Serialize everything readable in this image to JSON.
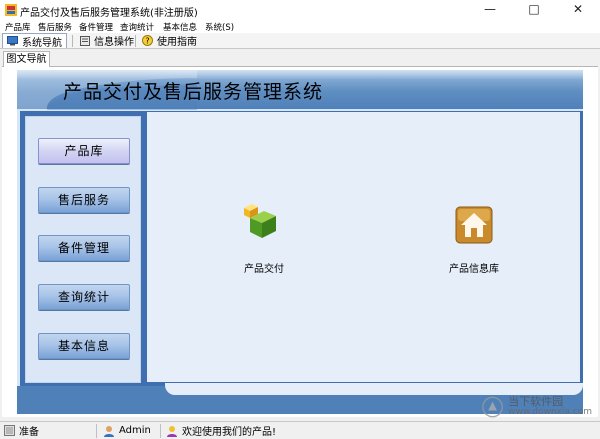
{
  "window": {
    "title": "产品交付及售后服务管理系统(非注册版)"
  },
  "menu": [
    "产品库",
    "售后服务",
    "备件管理",
    "查询统计",
    "基本信息",
    "系统(S)"
  ],
  "toolbar": {
    "nav_label": "系统导航",
    "info_label": "信息操作",
    "help_label": "使用指南"
  },
  "doc_tab": "图文导航",
  "banner_title": "产品交付及售后服务管理系统",
  "nav_buttons": [
    "产品库",
    "售后服务",
    "备件管理",
    "查询统计",
    "基本信息"
  ],
  "content": {
    "items": [
      {
        "label": "产品交付",
        "icon": "green-cube-icon"
      },
      {
        "label": "产品信息库",
        "icon": "house-icon"
      }
    ]
  },
  "status": {
    "ready": "准备",
    "user": "Admin",
    "welcome": "欢迎使用我们的产品!"
  },
  "watermark": {
    "name": "当下软件园",
    "url": "www.downxia.com"
  },
  "colors": {
    "banner": "#5f8ec2",
    "frame": "#3f6fb0",
    "panel": "#d6e6f7"
  }
}
